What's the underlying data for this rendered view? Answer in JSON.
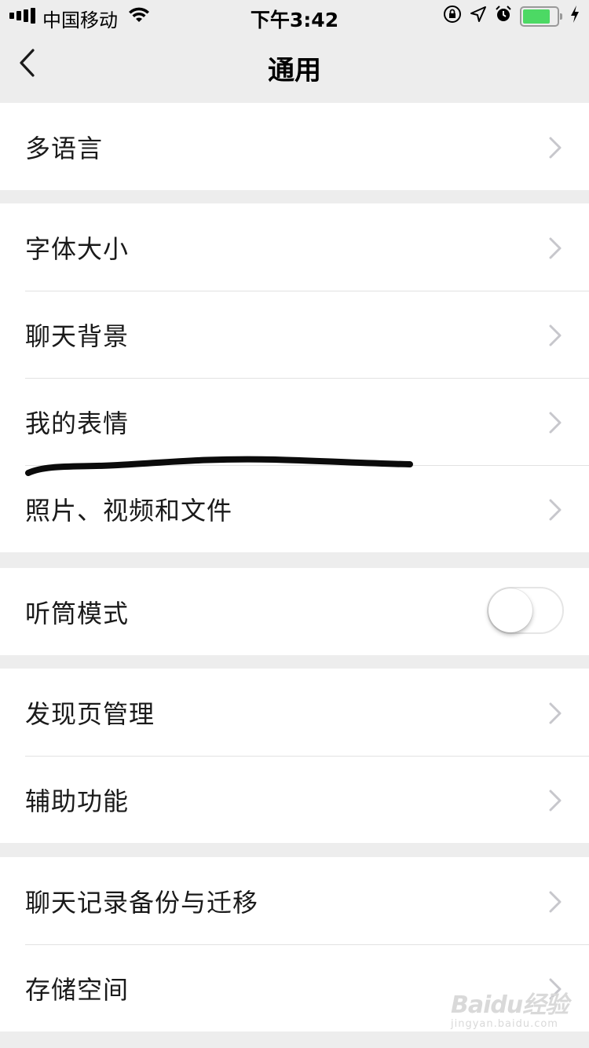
{
  "status_bar": {
    "carrier": "中国移动",
    "time": "下午3:42",
    "battery_level": 0.85,
    "icons": [
      "signal-icon",
      "wifi-icon",
      "orientation-lock-icon",
      "location-icon",
      "alarm-icon",
      "battery-icon",
      "charging-icon"
    ]
  },
  "nav": {
    "title": "通用",
    "back_icon": "chevron-left-icon"
  },
  "groups": [
    {
      "items": [
        {
          "label": "多语言",
          "accessory": "chevron"
        }
      ]
    },
    {
      "items": [
        {
          "label": "字体大小",
          "accessory": "chevron"
        },
        {
          "label": "聊天背景",
          "accessory": "chevron"
        },
        {
          "label": "我的表情",
          "accessory": "chevron"
        },
        {
          "label": "照片、视频和文件",
          "accessory": "chevron"
        }
      ]
    },
    {
      "items": [
        {
          "label": "听筒模式",
          "accessory": "toggle",
          "toggle_on": false
        }
      ]
    },
    {
      "items": [
        {
          "label": "发现页管理",
          "accessory": "chevron"
        },
        {
          "label": "辅助功能",
          "accessory": "chevron"
        }
      ]
    },
    {
      "items": [
        {
          "label": "聊天记录备份与迁移",
          "accessory": "chevron"
        },
        {
          "label": "存储空间",
          "accessory": "chevron"
        }
      ]
    }
  ],
  "watermark": {
    "logo": "Baidu经验",
    "url": "jingyan.baidu.com"
  },
  "colors": {
    "background": "#ededed",
    "row": "#ffffff",
    "toggle_off": "#e5e5e5",
    "battery": "#4cd964"
  }
}
